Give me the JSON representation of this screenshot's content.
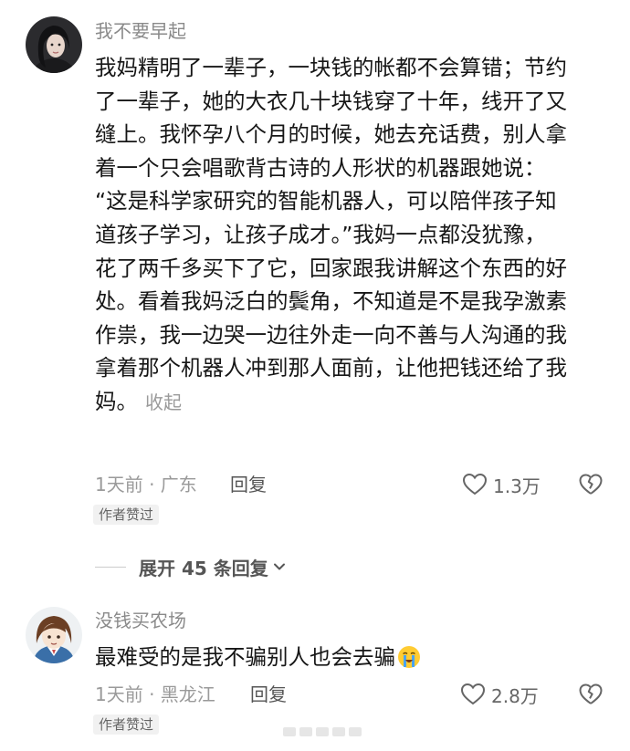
{
  "comments": [
    {
      "username": "我不要早起",
      "content_lines": [
        "我妈精明了一辈子，一块钱的帐都不会算错；节约",
        "了一辈子，她的大衣几十块钱穿了十年，线开了又",
        "缝上。我怀孕八个月的时候，她去充话费，别人拿",
        "着一个只会唱歌背古诗的人形状的机器跟她说：",
        "“这是科学家研究的智能机器人，可以陪伴孩子知",
        "道孩子学习，让孩子成才。”我妈一点都没犹豫，",
        "花了两千多买下了它，回家跟我讲解这个东西的好",
        "处。看着我妈泛白的鬓角，不知道是不是我孕激素",
        "作祟，我一边哭一边往外走一向不善与人沟通的我",
        "拿着那个机器人冲到那人面前，让他把钱还给了我",
        "妈。"
      ],
      "collapse_label": "收起",
      "time_location": "1天前 · 广东",
      "reply_label": "回复",
      "like_count": "1.3万",
      "badge": "作者赞过"
    },
    {
      "username": "没钱买农场",
      "content": "最难受的是我不骗别人也会去骗",
      "emoji": "loudly-crying-face",
      "time_location": "1天前 · 黑龙江",
      "reply_label": "回复",
      "like_count": "2.8万",
      "badge": "作者赞过"
    }
  ],
  "expand_replies": {
    "label": "展开 45 条回复",
    "icon": "chevron-down-icon"
  },
  "colors": {
    "username": "#8a8a8a",
    "content": "#161616",
    "meta": "#9a9a9a",
    "badge_bg": "#f1f1f1"
  }
}
